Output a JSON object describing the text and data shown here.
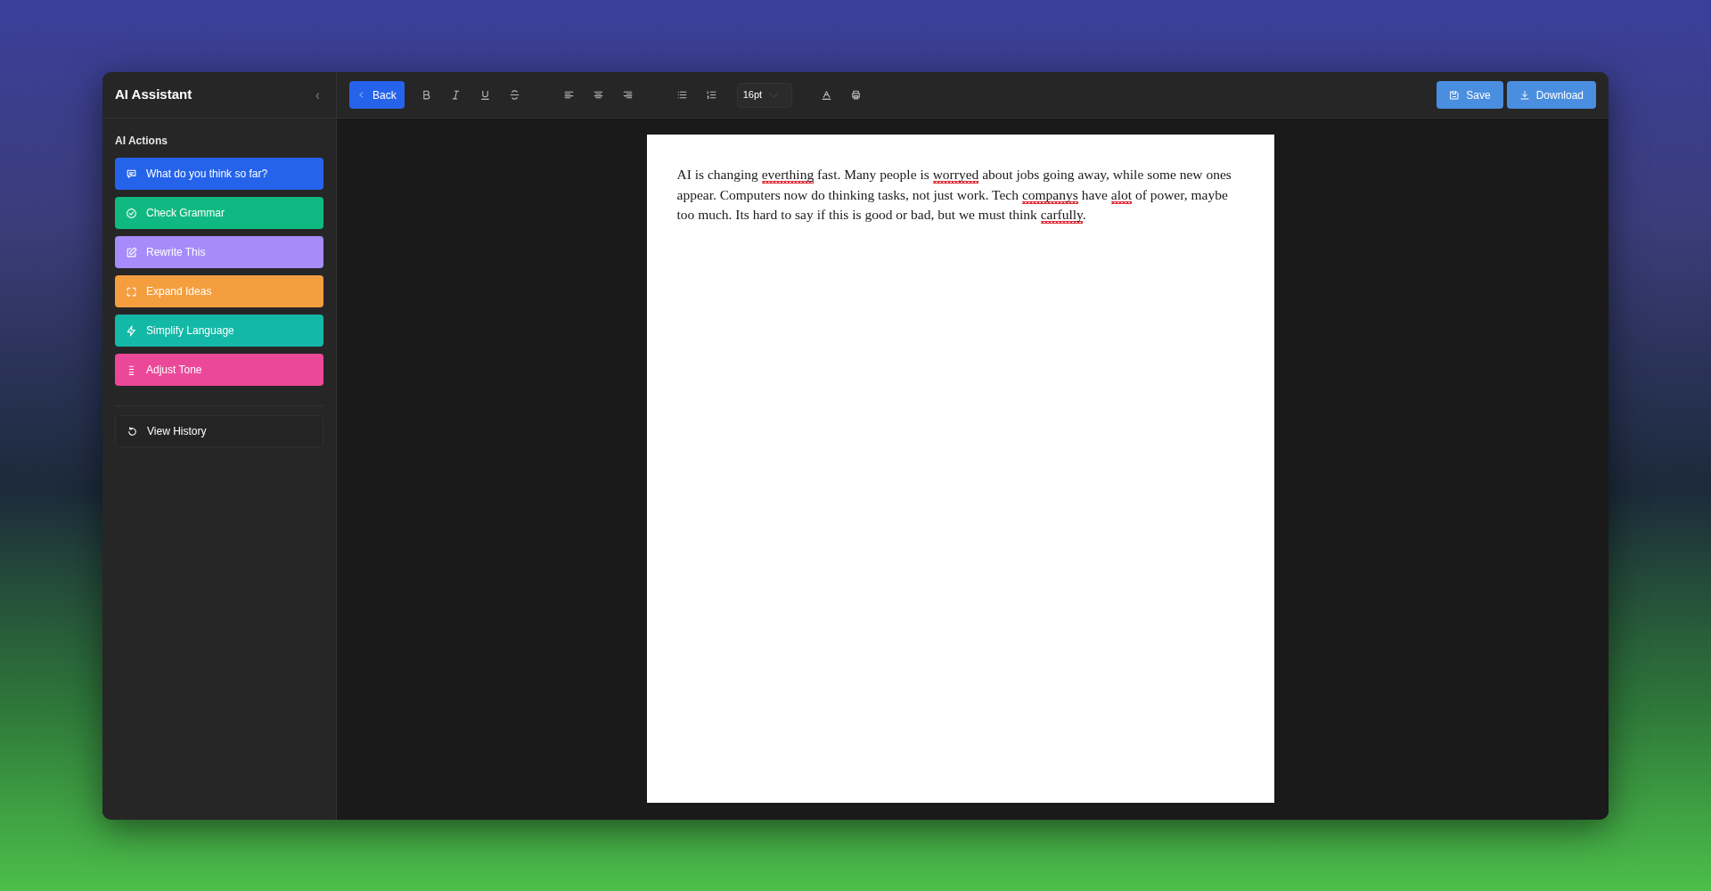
{
  "sidebar": {
    "title": "AI Assistant",
    "collapse_icon": "‹",
    "section_label": "AI Actions",
    "actions": [
      {
        "label": "What do you think so far?",
        "color": "#2563eb"
      },
      {
        "label": "Check Grammar",
        "color": "#10b981"
      },
      {
        "label": "Rewrite This",
        "color": "#a78bfa"
      },
      {
        "label": "Expand Ideas",
        "color": "#f59e3f"
      },
      {
        "label": "Simplify Language",
        "color": "#14b8a6"
      },
      {
        "label": "Adjust Tone",
        "color": "#ec4899"
      }
    ],
    "history_button": "View History"
  },
  "toolbar": {
    "back": "Back",
    "font_size": "16pt",
    "save": "Save",
    "download": "Download"
  },
  "document": {
    "segments": [
      {
        "text": "AI is changing ",
        "misspelled": false
      },
      {
        "text": "everthing",
        "misspelled": true
      },
      {
        "text": " fast. Many people is ",
        "misspelled": false
      },
      {
        "text": "worryed",
        "misspelled": true
      },
      {
        "text": " about jobs going away, while some new ones appear. Computers now do thinking tasks, not just work. Tech ",
        "misspelled": false
      },
      {
        "text": "companys",
        "misspelled": true
      },
      {
        "text": " have ",
        "misspelled": false
      },
      {
        "text": "alot",
        "misspelled": true
      },
      {
        "text": " of power, maybe too much. Its hard to say if this is good or bad, but we must think ",
        "misspelled": false
      },
      {
        "text": "carfully",
        "misspelled": true
      },
      {
        "text": ".",
        "misspelled": false
      }
    ]
  }
}
